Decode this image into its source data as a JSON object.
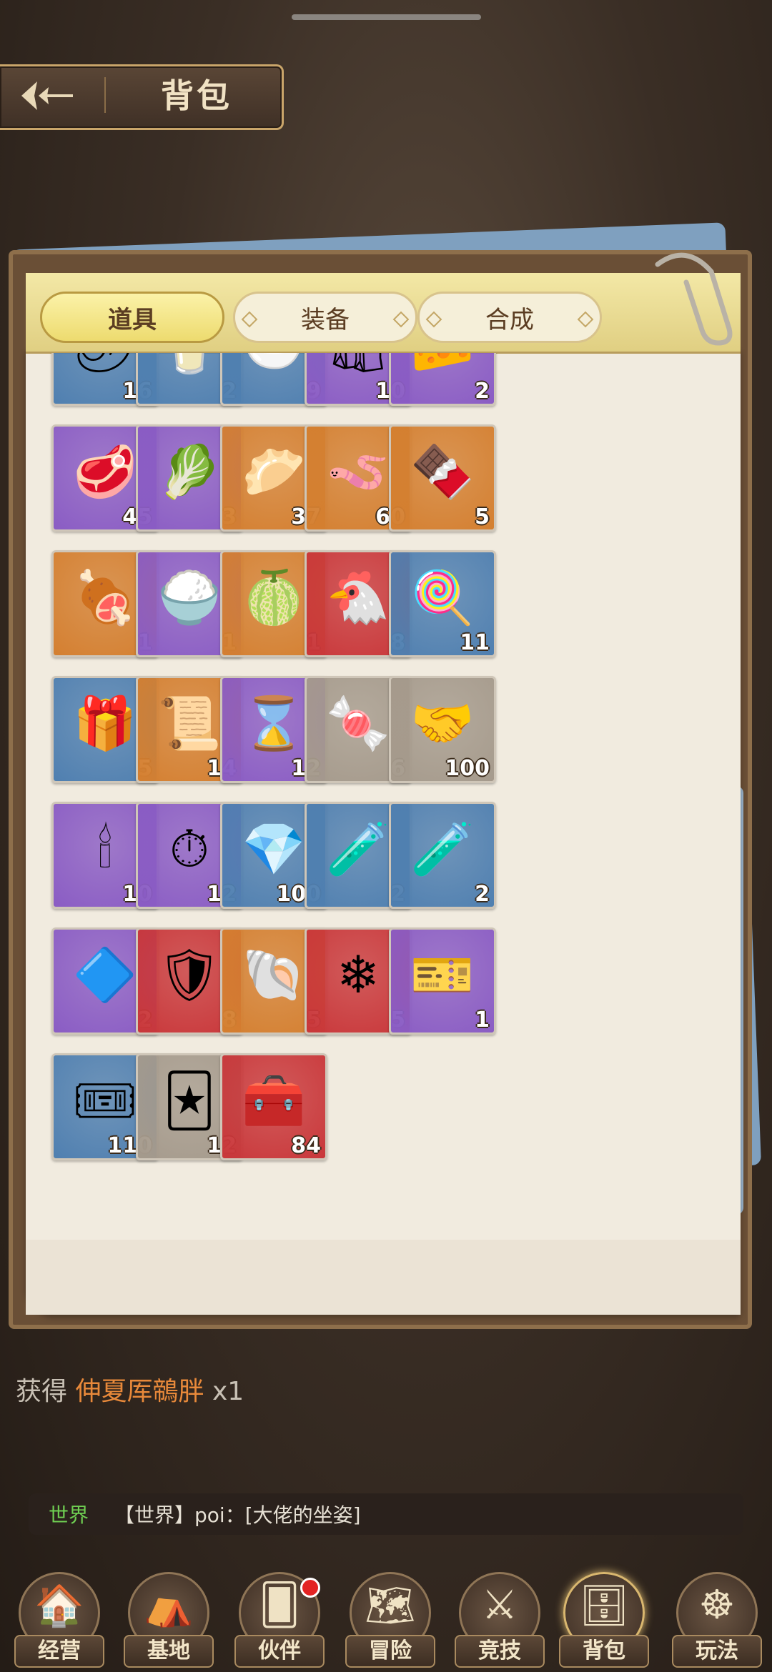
{
  "header": {
    "title": "背包"
  },
  "tabs": [
    {
      "label": "道具",
      "active": true
    },
    {
      "label": "装备",
      "active": false
    },
    {
      "label": "合成",
      "active": false
    }
  ],
  "colors": {
    "orange": "#d47f30",
    "purple": "#8a5cc4",
    "blue": "#4f7fb0",
    "red": "#c9373a",
    "gray": "#a59a8c"
  },
  "items": [
    {
      "icon": "chili-pepper-icon",
      "glyph": "🌶",
      "count": "16",
      "bg": "blue"
    },
    {
      "icon": "glass-icon",
      "glyph": "🥛",
      "count": "2",
      "bg": "blue"
    },
    {
      "icon": "salad-plate-icon",
      "glyph": "🥗",
      "count": "9",
      "bg": "blue"
    },
    {
      "icon": "sack-icon",
      "glyph": "🛍",
      "count": "10",
      "bg": "purple"
    },
    {
      "icon": "cheese-plate-icon",
      "glyph": "🧀",
      "count": "2",
      "bg": "purple"
    },
    {
      "icon": "steak-icon",
      "glyph": "🥩",
      "count": "45",
      "bg": "purple"
    },
    {
      "icon": "bok-choy-icon",
      "glyph": "🥬",
      "count": "3",
      "bg": "purple"
    },
    {
      "icon": "dumpling-plate-icon",
      "glyph": "🥟",
      "count": "37",
      "bg": "orange"
    },
    {
      "icon": "worm-icon",
      "glyph": "🪱",
      "count": "60",
      "bg": "orange"
    },
    {
      "icon": "chocolate-bar-icon",
      "glyph": "🍫",
      "count": "5",
      "bg": "orange"
    },
    {
      "icon": "ham-leg-icon",
      "glyph": "🍖",
      "count": "1",
      "bg": "orange"
    },
    {
      "icon": "rice-bowl-icon",
      "glyph": "🍚",
      "count": "1",
      "bg": "purple"
    },
    {
      "icon": "durian-icon",
      "glyph": "🍈",
      "count": "1",
      "bg": "orange"
    },
    {
      "icon": "chicken-icon",
      "glyph": "🐔",
      "count": "8",
      "bg": "red"
    },
    {
      "icon": "lollipop-icon",
      "glyph": "🍭",
      "count": "11",
      "bg": "blue"
    },
    {
      "icon": "gift-box-icon",
      "glyph": "🎁",
      "count": "5",
      "bg": "blue"
    },
    {
      "icon": "scroll-tickets-icon",
      "glyph": "📜",
      "count": "14",
      "bg": "orange"
    },
    {
      "icon": "hourglass-icon",
      "glyph": "⌛",
      "count": "12",
      "bg": "purple"
    },
    {
      "icon": "candy-card-icon",
      "glyph": "🍬",
      "count": "6",
      "bg": "gray"
    },
    {
      "icon": "handshake-card-icon",
      "glyph": "🤝",
      "count": "100",
      "bg": "gray"
    },
    {
      "icon": "candle-icon",
      "glyph": "🕯",
      "count": "10",
      "bg": "purple"
    },
    {
      "icon": "pocket-watch-icon",
      "glyph": "⏱",
      "count": "12",
      "bg": "purple"
    },
    {
      "icon": "crystal-shards-icon",
      "glyph": "💎",
      "count": "100",
      "bg": "blue"
    },
    {
      "icon": "blue-potion-icon",
      "glyph": "🧪",
      "count": "2",
      "bg": "blue"
    },
    {
      "icon": "yellow-potion-icon",
      "glyph": "🧪",
      "count": "2",
      "bg": "blue"
    },
    {
      "icon": "blue-gem-icon",
      "glyph": "🔷",
      "count": "2",
      "bg": "purple"
    },
    {
      "icon": "heart-badge-icon",
      "glyph": "🛡",
      "count": "8",
      "bg": "red"
    },
    {
      "icon": "shell-orb-icon",
      "glyph": "🐚",
      "count": "5",
      "bg": "orange"
    },
    {
      "icon": "snowflake-icon",
      "glyph": "❄",
      "count": "5",
      "bg": "red"
    },
    {
      "icon": "time-ticket-icon",
      "glyph": "🎫",
      "count": "1",
      "bg": "purple"
    },
    {
      "icon": "mix-ticket-icon",
      "glyph": "🎟",
      "count": "110",
      "bg": "blue"
    },
    {
      "icon": "mix-card-icon",
      "glyph": "🃏",
      "count": "12",
      "bg": "gray"
    },
    {
      "icon": "treasure-chest-icon",
      "glyph": "🧰",
      "count": "84",
      "bg": "red"
    }
  ],
  "message": {
    "prefix": "获得",
    "highlight": "伸夏厍鶙胖",
    "suffix": "x1"
  },
  "chat": {
    "channel": "世界",
    "text": "【世界】poi：[大佬的坐姿]"
  },
  "nav": [
    {
      "label": "经营",
      "icon": "house-icon",
      "glyph": "🏠",
      "active": false,
      "badge": false
    },
    {
      "label": "基地",
      "icon": "tent-icon",
      "glyph": "⛺",
      "active": false,
      "badge": false
    },
    {
      "label": "伙伴",
      "icon": "cards-icon",
      "glyph": "🂠",
      "active": false,
      "badge": true
    },
    {
      "label": "冒险",
      "icon": "map-icon",
      "glyph": "🗺",
      "active": false,
      "badge": false
    },
    {
      "label": "竞技",
      "icon": "swords-icon",
      "glyph": "⚔",
      "active": false,
      "badge": false
    },
    {
      "label": "背包",
      "icon": "wardrobe-icon",
      "glyph": "🗄",
      "active": true,
      "badge": false
    },
    {
      "label": "玩法",
      "icon": "ship-wheel-icon",
      "glyph": "☸",
      "active": false,
      "badge": false
    }
  ]
}
